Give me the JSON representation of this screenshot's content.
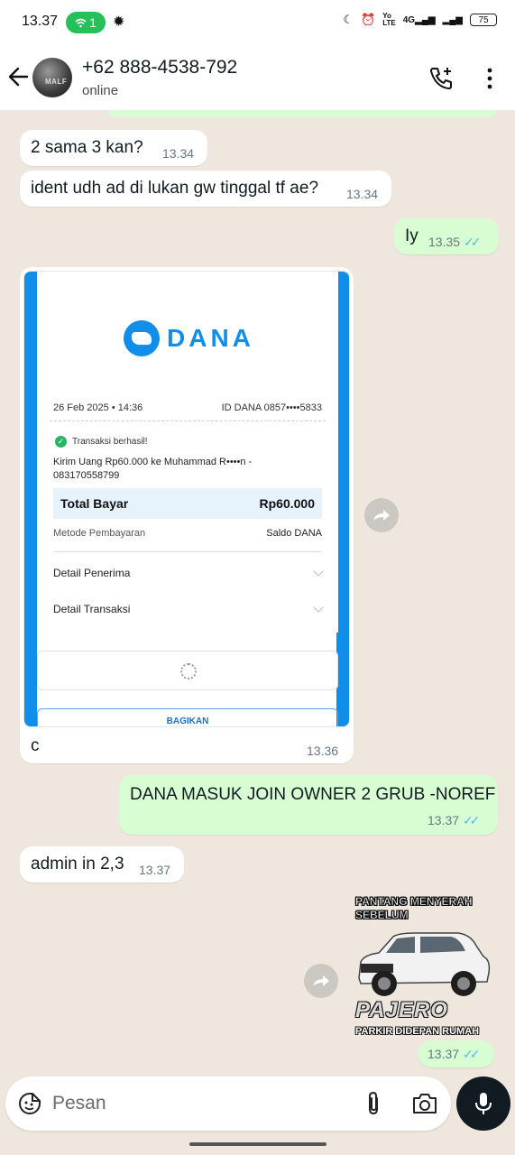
{
  "status_bar": {
    "time": "13.37",
    "notif_count": "1",
    "network_small_1": "Yo",
    "network_small_2": "LTE",
    "network_type": "4G",
    "battery": "75"
  },
  "header": {
    "contact_name": "+62 888-4538-792",
    "contact_status": "online",
    "avatar_text": "MALF"
  },
  "messages": [
    {
      "text": "2 sama 3 kan?",
      "time": "13.34",
      "dir": "in"
    },
    {
      "text": "ident udh ad di lukan gw tinggal tf ae?",
      "time": "13.34",
      "dir": "in"
    },
    {
      "text": "Iy",
      "time": "13.35",
      "dir": "out",
      "ticks": "✓✓"
    },
    {
      "text": "c",
      "time": "13.36",
      "dir": "in"
    },
    {
      "text": "DANA MASUK JOIN OWNER 2 GRUB -NOREF",
      "time": "13.37",
      "dir": "out",
      "ticks": "✓✓"
    },
    {
      "text": "admin in 2,3",
      "time": "13.37",
      "dir": "in"
    },
    {
      "text": "",
      "time": "13.37",
      "dir": "out",
      "ticks": "✓✓"
    }
  ],
  "receipt": {
    "brand": "DANA",
    "date": "26 Feb 2025 • 14:36",
    "id": "ID DANA 0857••••5833",
    "status": "Transaksi berhasil!",
    "description": "Kirim Uang Rp60.000 ke Muhammad R••••n - 083170558799",
    "total_label": "Total Bayar",
    "total_value": "Rp60.000",
    "method_label": "Metode Pembayaran",
    "method_value": "Saldo DANA",
    "row1": "Detail Penerima",
    "row2": "Detail Transaksi",
    "share": "BAGIKAN"
  },
  "sticker": {
    "top_text": "PANTANG MENYERAH SEBELUM",
    "brand": "PAJERO",
    "bottom_text": "PARKIR DIDEPAN RUMAH"
  },
  "input": {
    "placeholder": "Pesan"
  },
  "colors": {
    "incoming": "#ffffff",
    "outgoing": "#d9fdd3",
    "tick": "#53bdeb",
    "dana": "#118eea"
  }
}
